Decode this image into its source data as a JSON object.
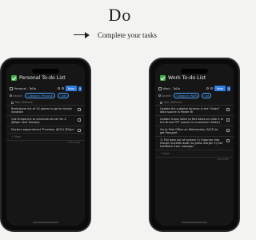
{
  "heading": "Do",
  "tagline": "Complete your tasks",
  "left_phone": {
    "icon": "check-square-icon",
    "title": "Personal To-do List",
    "view": "Personal - ToDo",
    "new_label": "New",
    "search_label": "Search",
    "filter_label": "Category: Personal",
    "filter2_label": "Cate",
    "list_header": "Task (Reflsed)",
    "tasks": [
      "Brainstorm list of 10 places to go for family vacation",
      "Call Gregorio's to schedule dinner for 4 @8pm next Tuesday",
      "Doctors appointment Thursday (6/22) @5pm"
    ],
    "new_row": "+ New",
    "calc": "Calculate"
  },
  "right_phone": {
    "icon": "check-square-icon",
    "title": "Work To-do List",
    "view": "Work - ToDo",
    "new_label": "New",
    "search_label": "Search",
    "filter_label": "Category: Work",
    "filter2_label": "Cat",
    "list_header": "Task (Reflsed)",
    "tasks": [
      "Update the subtotal formula in the \"Sales\" data source in Power BI",
      "Update Gross Sales to Net Sales on slide 5 of the Brand PPT (saved in \\customers folder)",
      "Go to Post Office on Wednesday (5/23) to get Passport",
      "1) Pull data out of system 2) Organize into margin buckets down to gross margin 3) Get feedback from manager"
    ],
    "new_row": "+ New",
    "calc": "Calculate"
  }
}
